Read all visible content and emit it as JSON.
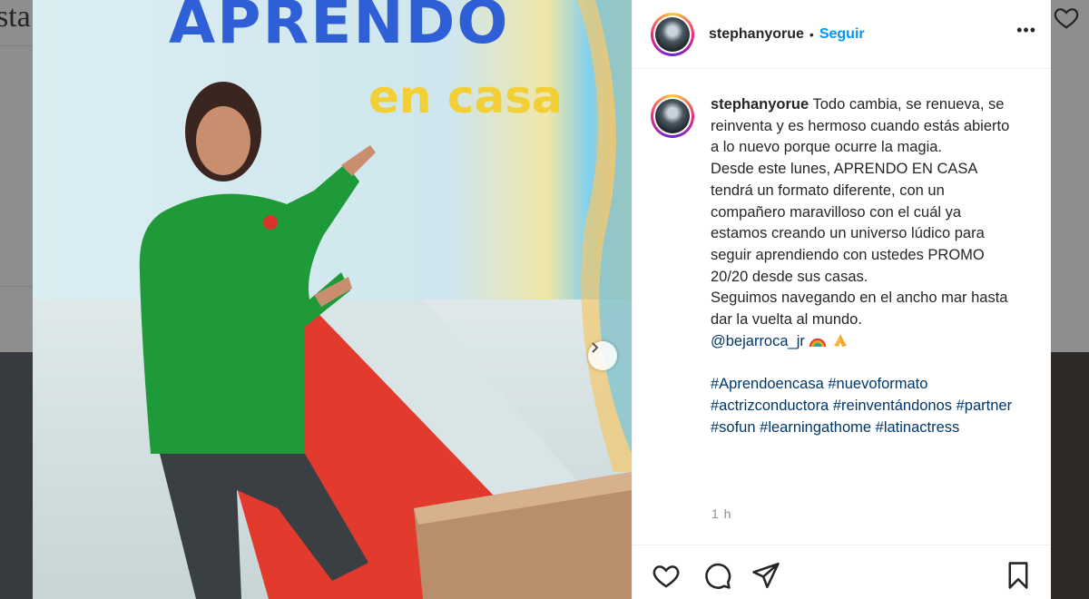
{
  "background": {
    "brand": "sta"
  },
  "post": {
    "header": {
      "username": "stephanyorue",
      "separator": "•",
      "follow_label": "Seguir",
      "more_label": "•••"
    },
    "caption": {
      "username": "stephanyorue",
      "line1": "Todo cambia, se renueva, se reinventa y es hermoso cuando estás abierto a lo nuevo porque ocurre la magia.",
      "line2": "Desde este lunes, APRENDO EN CASA tendrá un formato diferente, con un compañero maravilloso con el cuál ya estamos creando un universo lúdico para seguir aprendiendo con ustedes PROMO 20/20 desde sus casas.",
      "line3": "Seguimos navegando en el ancho mar hasta dar la vuelta al mundo.",
      "mention": "@bejarroca_jr",
      "hashtags": [
        "#Aprendoencasa",
        "#nuevoformato",
        "#actrizconductora",
        "#reinventándonos",
        "#partner",
        "#sofun",
        "#learningathome",
        "#latinactress"
      ]
    },
    "time": "1 h",
    "photo": {
      "screen_title": "APRENDO",
      "screen_subtitle": "en casa"
    },
    "icons": {
      "like": "heart-icon",
      "comment": "comment-icon",
      "share": "send-icon",
      "save": "bookmark-icon",
      "next": "chevron-right-icon"
    },
    "colors": {
      "follow": "#0095f6",
      "link": "#00376b",
      "muted": "#8e8e8e"
    }
  }
}
